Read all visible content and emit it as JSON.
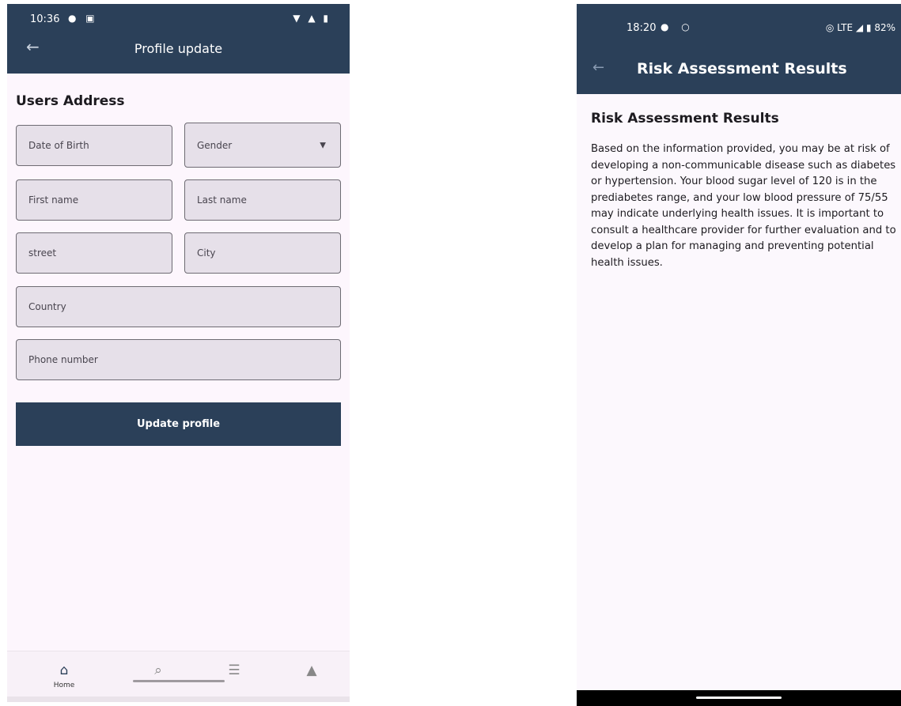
{
  "profile_screen": {
    "status": {
      "time": "10:36",
      "left_icons": "● ▣",
      "right_icons": "▼ ▲ ▮"
    },
    "appbar": {
      "back_icon": "←",
      "title": "Profile update"
    },
    "section_title": "Users Address",
    "fields": {
      "dob": "Date of Birth",
      "gender": "Gender",
      "first_name": "First name",
      "last_name": "Last name",
      "street": "street",
      "city": "City",
      "country": "Country",
      "phone": "Phone number"
    },
    "gender_caret": "▼",
    "update_button": "Update profile",
    "nav": {
      "home_icon": "⌂",
      "home_label": "Home",
      "search_icon": "⌕",
      "cart_icon": "☰",
      "profile_icon": "▲"
    }
  },
  "risk_screen": {
    "status": {
      "time": "18:20",
      "left_icons": "● ○",
      "right": "◎ LTE ◢ ▮ 82%"
    },
    "appbar": {
      "back_icon": "←",
      "title": "Risk Assessment Results"
    },
    "heading": "Risk Assessment Results",
    "body": "Based on the information provided, you may be at risk of developing a non-communicable disease such as diabetes or hypertension. Your blood sugar level of 120 is in the prediabetes range, and your low blood pressure of 75/55 may indicate underlying health issues. It is important to consult a healthcare provider for further evaluation and to develop a plan for managing and preventing potential health issues."
  },
  "colors": {
    "primary": "#2b4059",
    "background": "#fdf6fd",
    "field_fill": "#e6e0e9"
  }
}
